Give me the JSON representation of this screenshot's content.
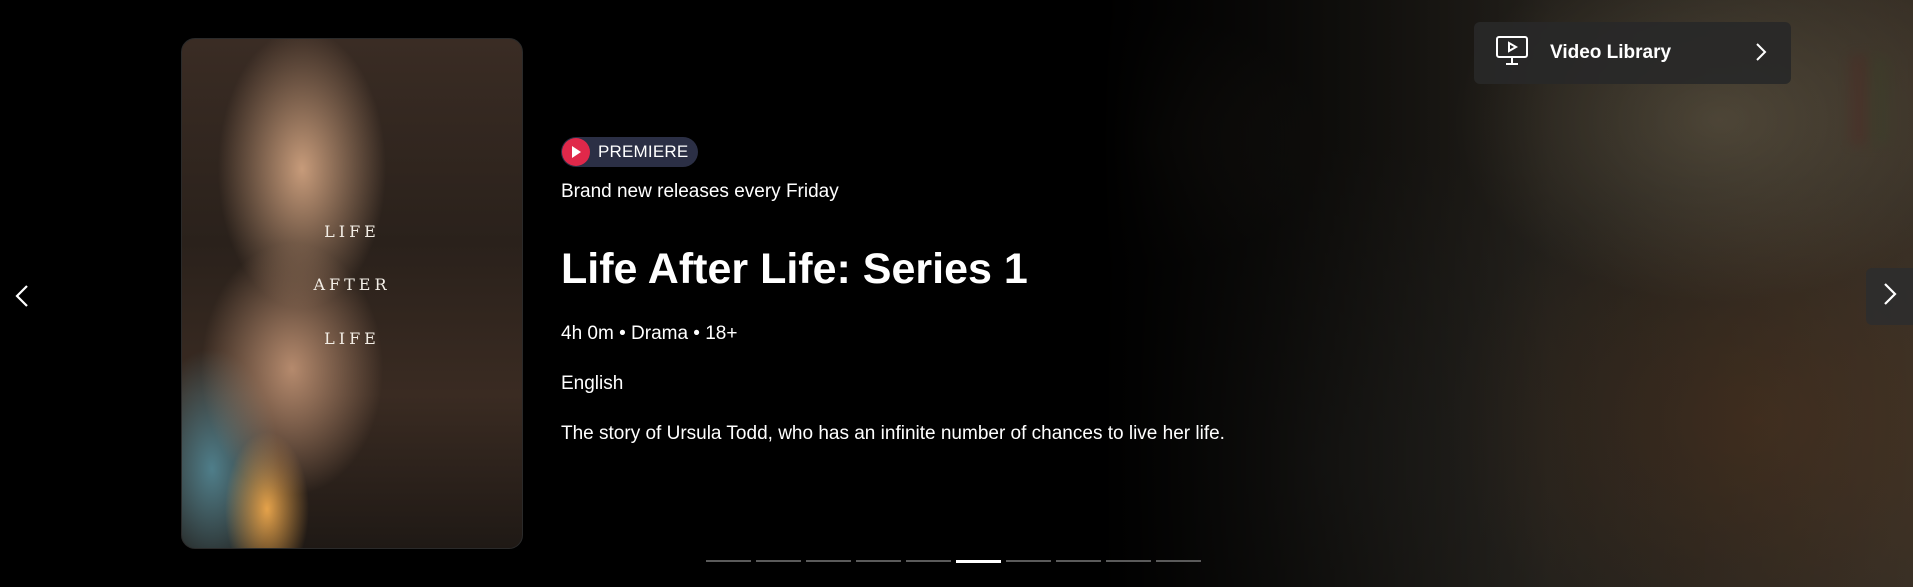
{
  "hero": {
    "poster": {
      "title_lines": [
        "LIFE",
        "AFTER",
        "LIFE"
      ]
    },
    "badge": {
      "icon": "play-icon",
      "label": "PREMIERE",
      "icon_color": "#e0284a"
    },
    "tagline": "Brand new releases every Friday",
    "title": "Life After Life: Series 1",
    "meta": "4h 0m • Drama • 18+",
    "language": "English",
    "synopsis": "The story of Ursula Todd, who has an infinite number of chances to live her life."
  },
  "video_library": {
    "icon": "monitor-play-icon",
    "label": "Video Library",
    "chevron": "chevron-right-icon"
  },
  "navigation": {
    "prev_icon": "chevron-left-icon",
    "next_icon": "chevron-right-icon"
  },
  "pager": {
    "total": 10,
    "active_index": 5
  }
}
